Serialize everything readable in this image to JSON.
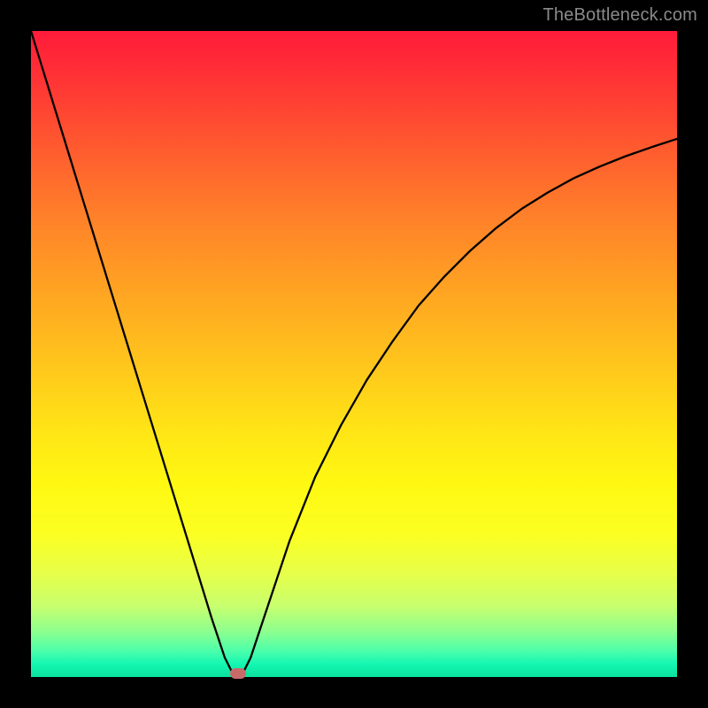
{
  "watermark": "TheBottleneck.com",
  "colors": {
    "frame": "#000000",
    "curve": "#000000",
    "marker": "#c96a6a",
    "gradient_top": "#ff1b3a",
    "gradient_bottom": "#0ae29c"
  },
  "chart_data": {
    "type": "line",
    "title": "",
    "xlabel": "",
    "ylabel": "",
    "xlim": [
      0,
      100
    ],
    "ylim": [
      0,
      100
    ],
    "x": [
      0,
      2,
      4,
      6,
      8,
      10,
      12,
      14,
      16,
      18,
      20,
      22,
      24,
      26,
      28,
      30,
      31,
      32,
      33,
      34,
      36,
      38,
      40,
      44,
      48,
      52,
      56,
      60,
      64,
      68,
      72,
      76,
      80,
      84,
      88,
      92,
      96,
      100
    ],
    "values": [
      100,
      93.5,
      87,
      80.5,
      74,
      67.5,
      61,
      54.5,
      48,
      41.5,
      35,
      28.5,
      22,
      15.5,
      9,
      3,
      1,
      0.5,
      1,
      3,
      9,
      15,
      21,
      31,
      39,
      46,
      52,
      57.5,
      62,
      66,
      69.5,
      72.5,
      75,
      77.2,
      79,
      80.6,
      82,
      83.3
    ],
    "marker": {
      "x": 32,
      "y": 0.5
    },
    "grid": false,
    "legend": false
  }
}
